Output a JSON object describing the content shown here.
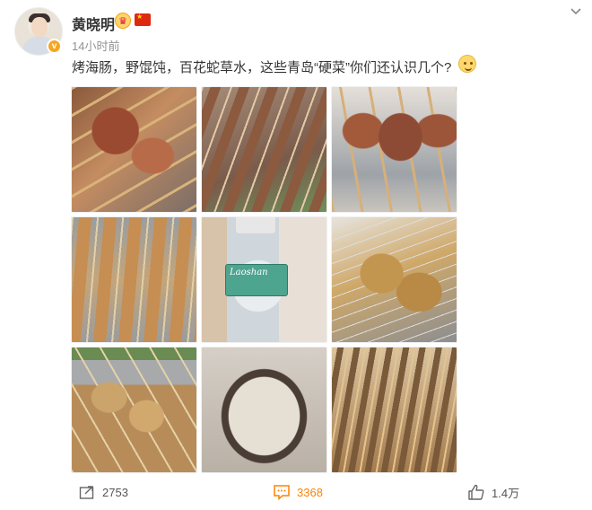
{
  "author": {
    "name": "黄晓明",
    "verified_badge": "v"
  },
  "post": {
    "time": "14小时前",
    "text": "烤海肠，野馄饨，百花蛇草水，这些青岛“硬菜”你们还认识几个?"
  },
  "bottle_label": "Laoshan",
  "actions": {
    "repost_count": "2753",
    "comment_count": "3368",
    "like_count": "1.4万"
  },
  "colors": {
    "comment_accent": "#ff8200",
    "secondary_text": "#939393",
    "primary_text": "#333333"
  },
  "icons": [
    "crown-icon",
    "china-flag-icon",
    "chevron-down-icon",
    "smile-emoji-icon",
    "repost-icon",
    "comment-icon",
    "like-icon"
  ]
}
